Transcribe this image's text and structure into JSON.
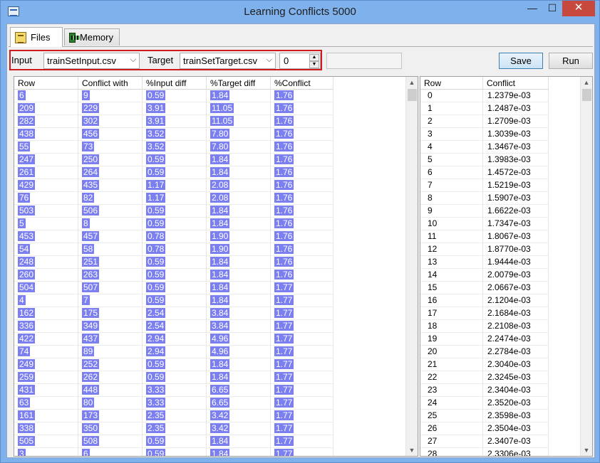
{
  "window": {
    "title": "Learning Conflicts 5000",
    "min_glyph": "—",
    "max_glyph": "☐",
    "close_glyph": "✕"
  },
  "tabs": [
    {
      "label": "Files",
      "icon": "files-icon",
      "active": true
    },
    {
      "label": "Memory",
      "icon": "memory-chip-icon",
      "active": false
    }
  ],
  "toolbar": {
    "input_label": "Input",
    "input_value": "trainSetInput.csv",
    "target_label": "Target",
    "target_value": "trainSetTarget.csv",
    "spin_value": "0",
    "save_label": "Save",
    "run_label": "Run"
  },
  "conflicts_table": {
    "headers": [
      "Row",
      "Conflict with",
      "%Input diff",
      "%Target diff",
      "%Conflict"
    ],
    "rows": [
      [
        "6",
        "9",
        "0.59",
        "1.84",
        "1.76"
      ],
      [
        "209",
        "229",
        "3.91",
        "11.05",
        "1.76"
      ],
      [
        "282",
        "302",
        "3.91",
        "11.05",
        "1.76"
      ],
      [
        "438",
        "456",
        "3.52",
        "7.80",
        "1.76"
      ],
      [
        "55",
        "73",
        "3.52",
        "7.80",
        "1.76"
      ],
      [
        "247",
        "250",
        "0.59",
        "1.84",
        "1.76"
      ],
      [
        "261",
        "264",
        "0.59",
        "1.84",
        "1.76"
      ],
      [
        "429",
        "435",
        "1.17",
        "2.08",
        "1.76"
      ],
      [
        "76",
        "82",
        "1.17",
        "2.08",
        "1.76"
      ],
      [
        "503",
        "506",
        "0.59",
        "1.84",
        "1.76"
      ],
      [
        "5",
        "8",
        "0.59",
        "1.84",
        "1.76"
      ],
      [
        "453",
        "457",
        "0.78",
        "1.90",
        "1.76"
      ],
      [
        "54",
        "58",
        "0.78",
        "1.90",
        "1.76"
      ],
      [
        "248",
        "251",
        "0.59",
        "1.84",
        "1.76"
      ],
      [
        "260",
        "263",
        "0.59",
        "1.84",
        "1.76"
      ],
      [
        "504",
        "507",
        "0.59",
        "1.84",
        "1.77"
      ],
      [
        "4",
        "7",
        "0.59",
        "1.84",
        "1.77"
      ],
      [
        "162",
        "175",
        "2.54",
        "3.84",
        "1.77"
      ],
      [
        "336",
        "349",
        "2.54",
        "3.84",
        "1.77"
      ],
      [
        "422",
        "437",
        "2.94",
        "4.96",
        "1.77"
      ],
      [
        "74",
        "89",
        "2.94",
        "4.96",
        "1.77"
      ],
      [
        "249",
        "252",
        "0.59",
        "1.84",
        "1.77"
      ],
      [
        "259",
        "262",
        "0.59",
        "1.84",
        "1.77"
      ],
      [
        "431",
        "448",
        "3.33",
        "6.65",
        "1.77"
      ],
      [
        "63",
        "80",
        "3.33",
        "6.65",
        "1.77"
      ],
      [
        "161",
        "173",
        "2.35",
        "3.42",
        "1.77"
      ],
      [
        "338",
        "350",
        "2.35",
        "3.42",
        "1.77"
      ],
      [
        "505",
        "508",
        "0.59",
        "1.84",
        "1.77"
      ],
      [
        "3",
        "6",
        "0.59",
        "1.84",
        "1.77"
      ]
    ]
  },
  "conflict_list": {
    "headers": [
      "Row",
      "Conflict"
    ],
    "rows": [
      [
        "0",
        "1.2379e-03"
      ],
      [
        "1",
        "1.2487e-03"
      ],
      [
        "2",
        "1.2709e-03"
      ],
      [
        "3",
        "1.3039e-03"
      ],
      [
        "4",
        "1.3467e-03"
      ],
      [
        "5",
        "1.3983e-03"
      ],
      [
        "6",
        "1.4572e-03"
      ],
      [
        "7",
        "1.5219e-03"
      ],
      [
        "8",
        "1.5907e-03"
      ],
      [
        "9",
        "1.6622e-03"
      ],
      [
        "10",
        "1.7347e-03"
      ],
      [
        "11",
        "1.8067e-03"
      ],
      [
        "12",
        "1.8770e-03"
      ],
      [
        "13",
        "1.9444e-03"
      ],
      [
        "14",
        "2.0079e-03"
      ],
      [
        "15",
        "2.0667e-03"
      ],
      [
        "16",
        "2.1204e-03"
      ],
      [
        "17",
        "2.1684e-03"
      ],
      [
        "18",
        "2.2108e-03"
      ],
      [
        "19",
        "2.2474e-03"
      ],
      [
        "20",
        "2.2784e-03"
      ],
      [
        "21",
        "2.3040e-03"
      ],
      [
        "22",
        "2.3245e-03"
      ],
      [
        "23",
        "2.3404e-03"
      ],
      [
        "24",
        "2.3520e-03"
      ],
      [
        "25",
        "2.3598e-03"
      ],
      [
        "26",
        "2.3504e-03"
      ],
      [
        "27",
        "2.3407e-03"
      ],
      [
        "28",
        "2.3306e-03"
      ]
    ]
  },
  "colors": {
    "highlight_border": "#d0191c",
    "cell_highlight": "#7b7ff0",
    "close_button": "#c7483d"
  }
}
